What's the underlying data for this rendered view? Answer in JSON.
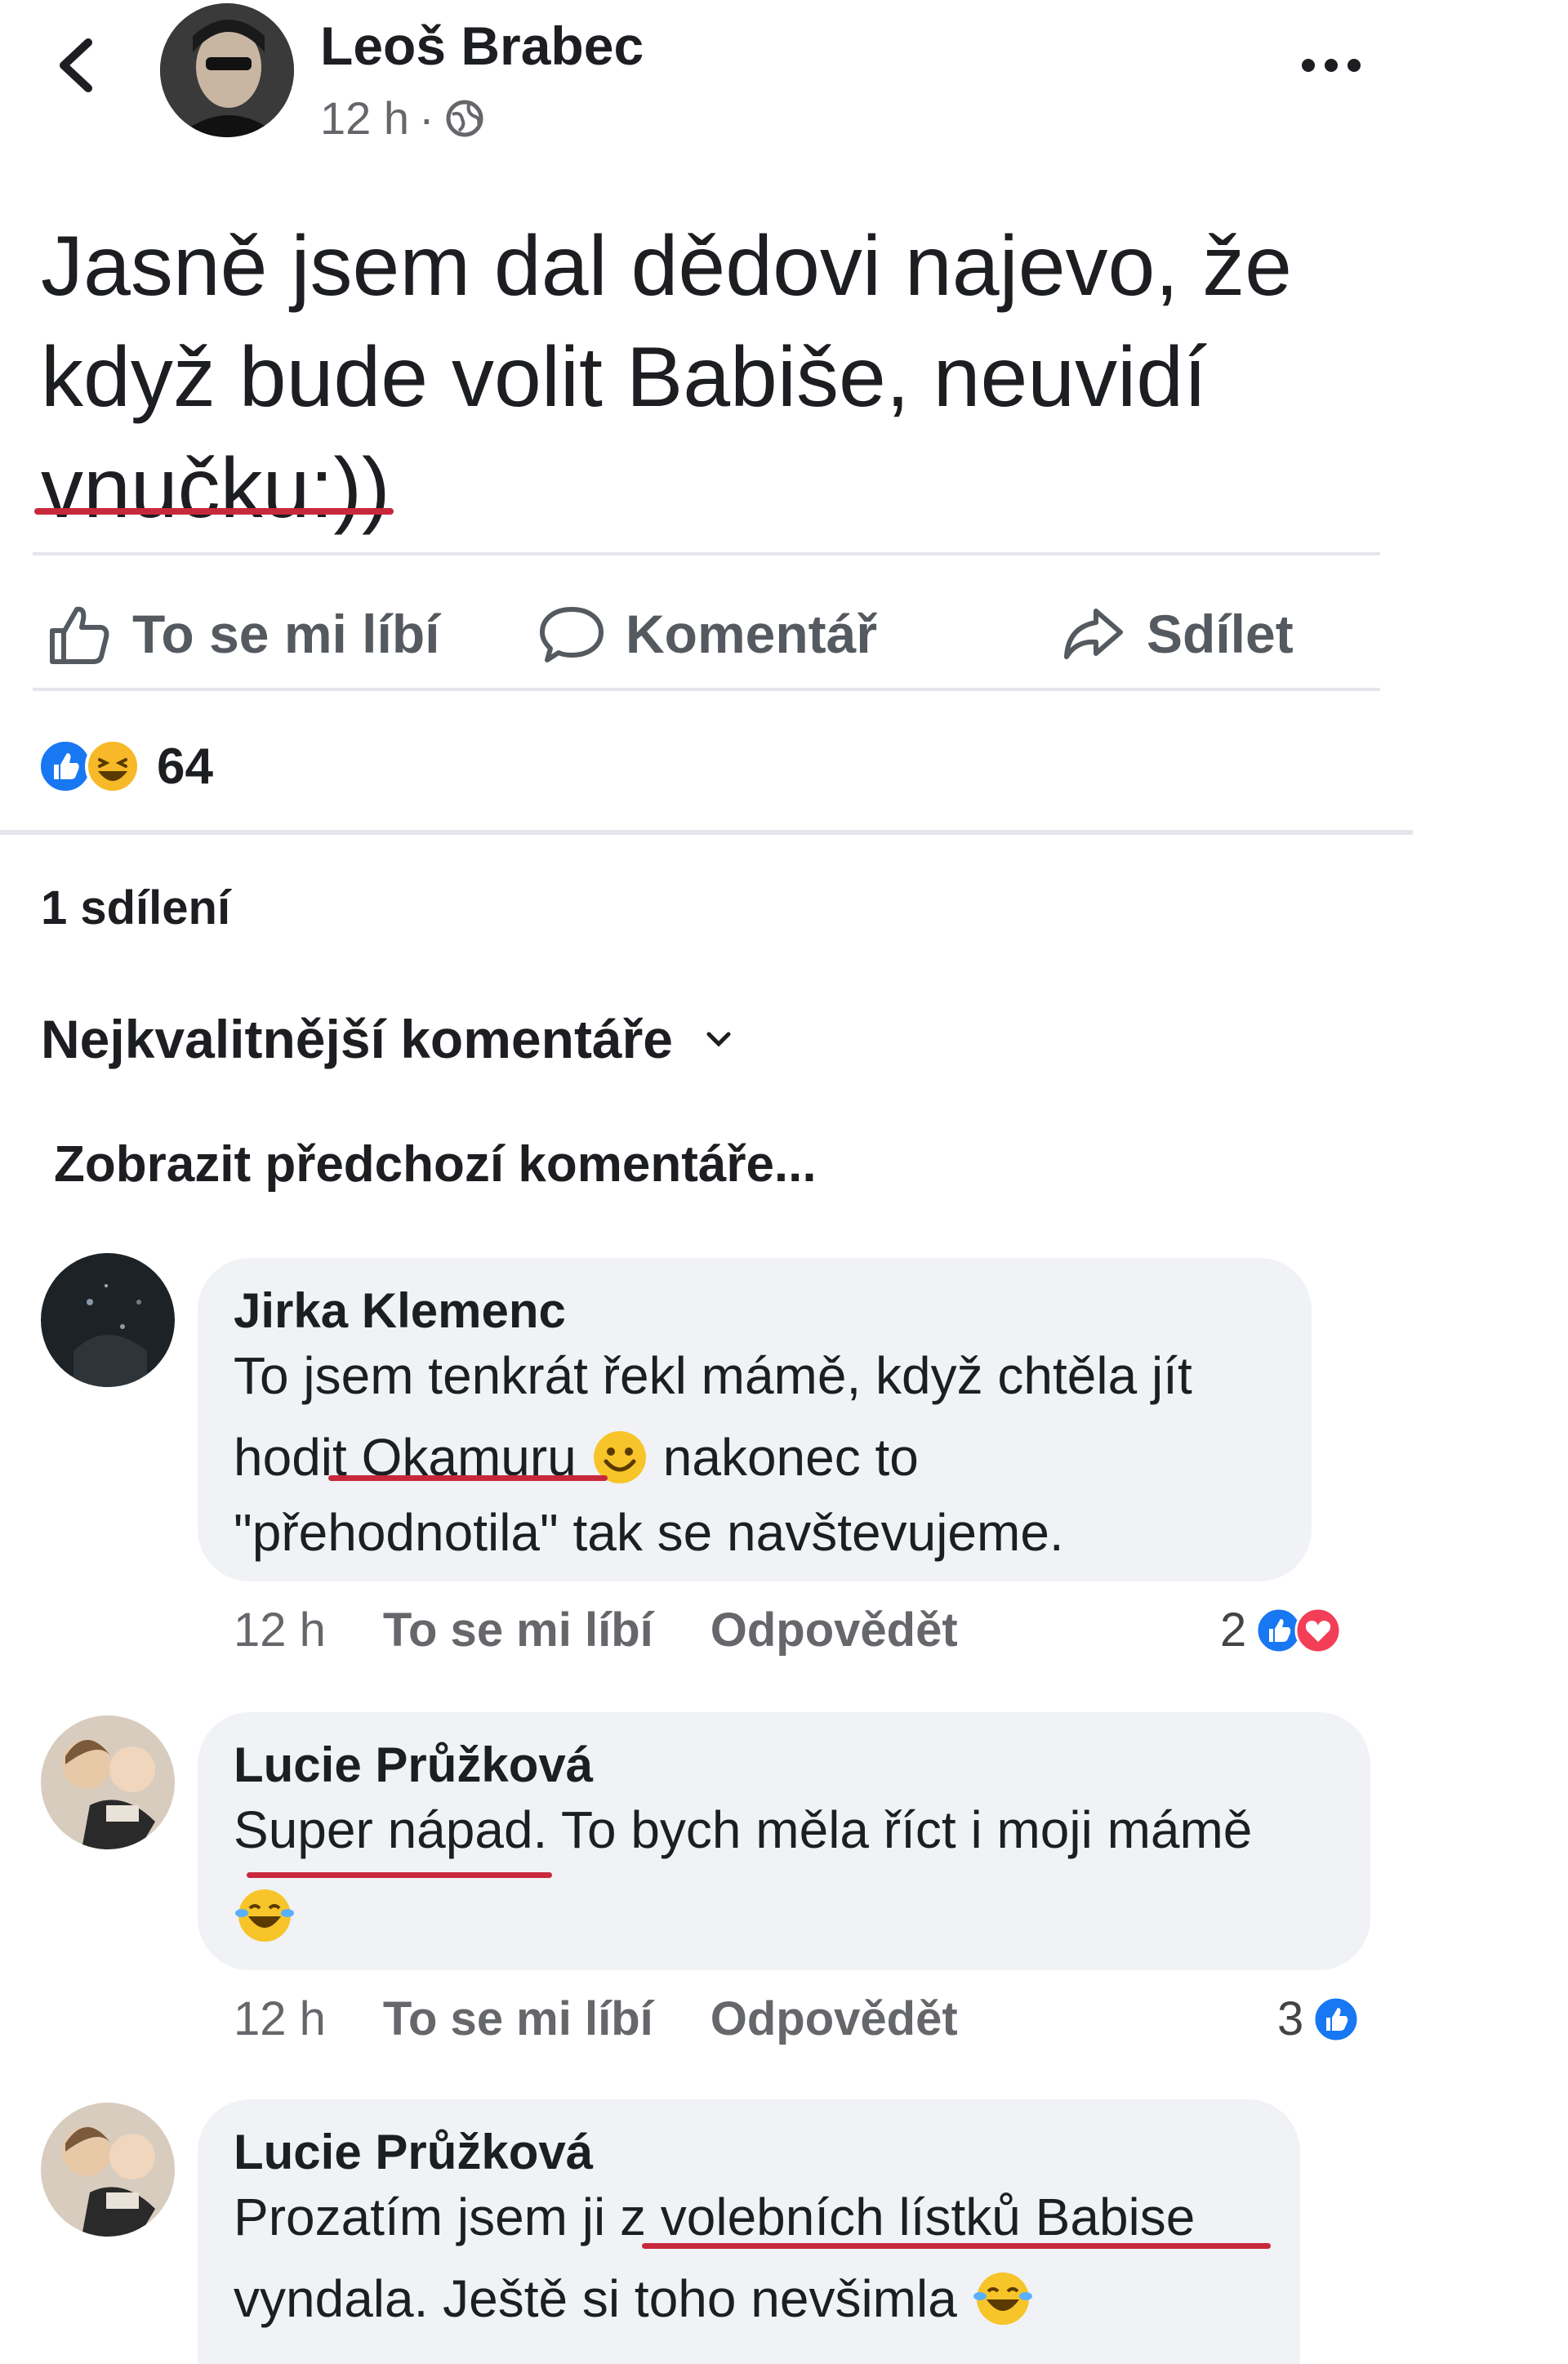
{
  "post": {
    "author": "Leoš Brabec",
    "time": "12 h",
    "separator": "·",
    "text": "Jasně jsem dal dědovi najevo, že když bude volit Babiše, neuvidí vnučku:))",
    "lines": [
      "Jasně jsem dal dědovi najevo, že",
      "když bude volit Babiše, neuvidí",
      "vnučku:))"
    ]
  },
  "actions": {
    "like": "To se mi líbí",
    "comment": "Komentář",
    "share": "Sdílet"
  },
  "reactions": {
    "count": "64"
  },
  "shares": "1 sdílení",
  "sort_label": "Nejkvalitnější komentáře",
  "prev_comments": "Zobrazit předchozí komentáře...",
  "comments": [
    {
      "name": "Jirka Klemenc",
      "line1": "To jsem tenkrát řekl mámě, když chtěla jít",
      "line2a": "hodit Okamuru",
      "line2b": "nakonec to",
      "line3": "\"přehodnotila\" tak se navštevujeme.",
      "time": "12 h",
      "like": "To se mi líbí",
      "reply": "Odpovědět",
      "reaction_count": "2"
    },
    {
      "name": "Lucie Průžková",
      "line1": "Super nápad. To bych měla říct i moji mámě",
      "time": "12 h",
      "like": "To se mi líbí",
      "reply": "Odpovědět",
      "reaction_count": "3"
    },
    {
      "name": "Lucie Průžková",
      "line1": "Prozatím jsem ji z volebních lístků Babise",
      "line2": "vyndala. Ještě si toho nevšimla"
    }
  ],
  "colors": {
    "underline": "#c8283c",
    "bubble": "#f0f2f5",
    "like_blue": "#1877f2",
    "love_red": "#f33e58",
    "haha_yellow": "#f7b928"
  }
}
